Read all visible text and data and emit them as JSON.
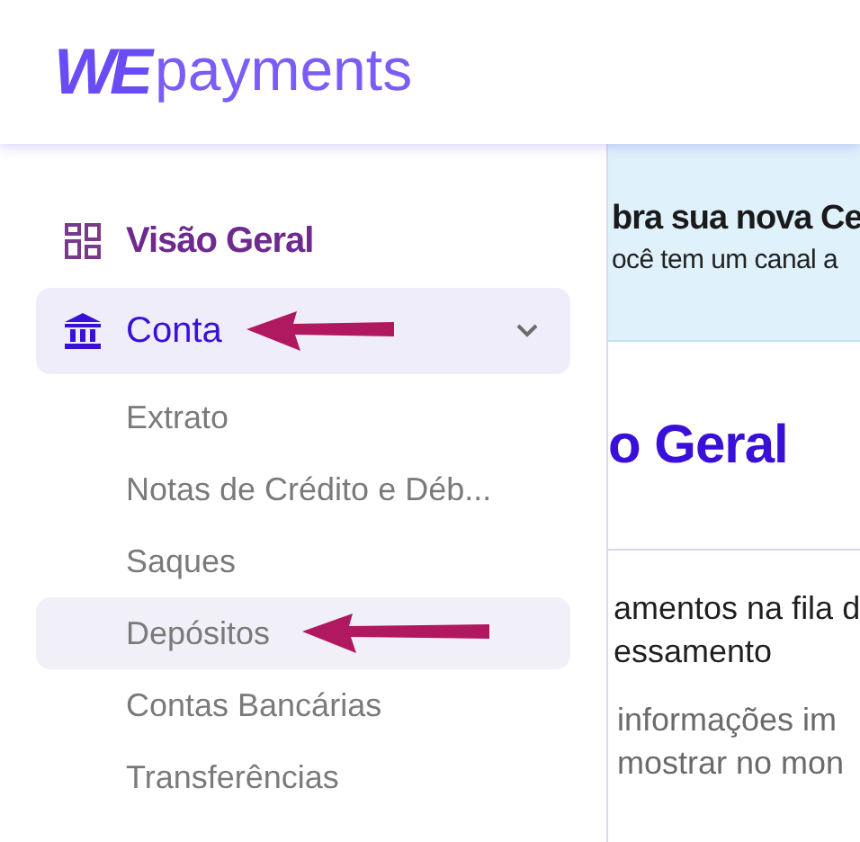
{
  "logo": {
    "mark": "WE",
    "text": "payments"
  },
  "nav": [
    {
      "label": "Visão Geral",
      "kind": "overview",
      "selected": true,
      "highlighted": false,
      "arrow": false
    },
    {
      "label": "Conta",
      "kind": "account",
      "selected": false,
      "highlighted": true,
      "arrow": true,
      "expanded": true,
      "children": [
        {
          "label": "Extrato",
          "highlighted": false,
          "arrow": false
        },
        {
          "label": "Notas de Crédito e Déb...",
          "highlighted": false,
          "arrow": false
        },
        {
          "label": "Saques",
          "highlighted": false,
          "arrow": false
        },
        {
          "label": "Depósitos",
          "highlighted": true,
          "arrow": true
        },
        {
          "label": "Contas Bancárias",
          "highlighted": false,
          "arrow": false
        },
        {
          "label": "Transferências",
          "highlighted": false,
          "arrow": false
        }
      ]
    }
  ],
  "banner": {
    "title": "bra sua nova Ce",
    "text": "ocê tem um canal a"
  },
  "heading": "o Geral",
  "notice": {
    "line_1": "amentos na fila d",
    "line_2": "essamento"
  },
  "info": {
    "line_1": "informações im",
    "line_2": "mostrar no mon"
  }
}
